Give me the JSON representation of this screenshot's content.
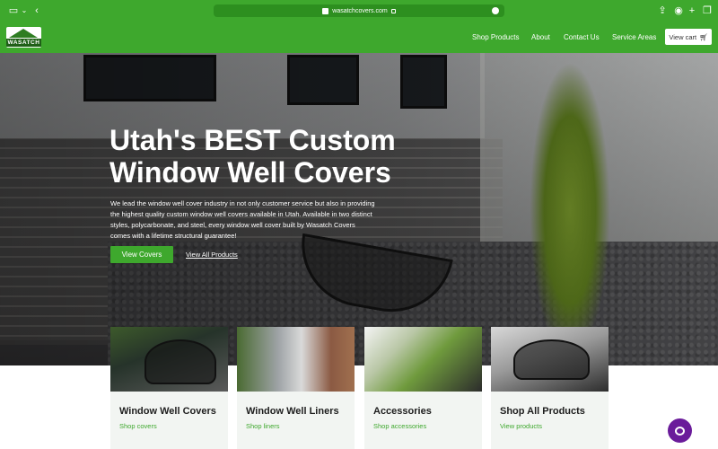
{
  "browser": {
    "url": "wasatchcovers.com",
    "icons": [
      "sidebar-icon",
      "chevron-down-icon",
      "back-icon",
      "share-icon",
      "extension-icon",
      "new-tab-icon",
      "tabs-icon"
    ]
  },
  "header": {
    "logo_text": "WASATCH",
    "nav": [
      "Shop Products",
      "About",
      "Contact Us",
      "Service Areas"
    ],
    "cart_label": "View cart",
    "accent_color": "#3ea82d"
  },
  "hero": {
    "title": "Utah's BEST Custom Window Well Covers",
    "description": "We lead the window well cover industry in not only customer service but also in providing the highest quality custom window well covers available in Utah. Available in two distinct styles, polycarbonate, and steel, every window well cover built by Wasatch Covers comes with a lifetime structural guarantee!",
    "primary_button": "View Covers",
    "secondary_link": "View All Products"
  },
  "cards": [
    {
      "title": "Window Well Covers",
      "link": "Shop covers"
    },
    {
      "title": "Window Well Liners",
      "link": "Shop liners"
    },
    {
      "title": "Accessories",
      "link": "Shop accessories"
    },
    {
      "title": "Shop All Products",
      "link": "View products"
    }
  ]
}
